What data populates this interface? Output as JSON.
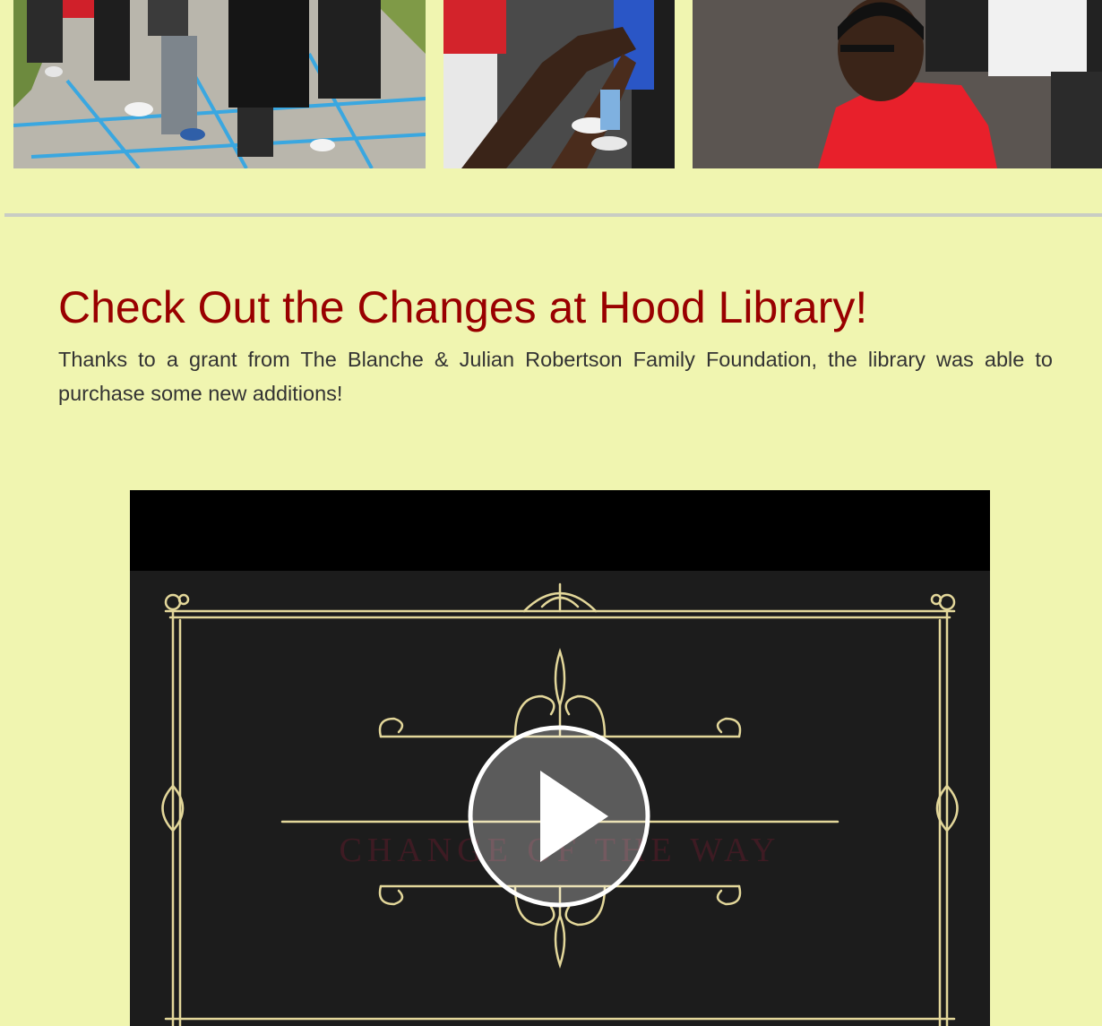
{
  "gallery": {
    "photos": [
      {
        "alt": "students-standing-on-painted-grid"
      },
      {
        "alt": "students-joining-hands"
      },
      {
        "alt": "student-in-red-shirt-seated"
      }
    ]
  },
  "article": {
    "headline": "Check Out the Changes at Hood Library!",
    "body": "Thanks to a grant from The Blanche & Julian Robertson Family Foundation, the library was able to purchase some new additions!"
  },
  "video": {
    "title_card_text": "CHANGE OF THE WAY",
    "play_icon": "play-icon",
    "colors": {
      "ornament": "#e3d79a",
      "card_background": "#1c1c1c",
      "title_text": "#5b1b2a"
    }
  },
  "colors": {
    "page_background": "#f0f5b0",
    "headline": "#990000",
    "body_text": "#333333",
    "divider": "#c9ccc4"
  }
}
